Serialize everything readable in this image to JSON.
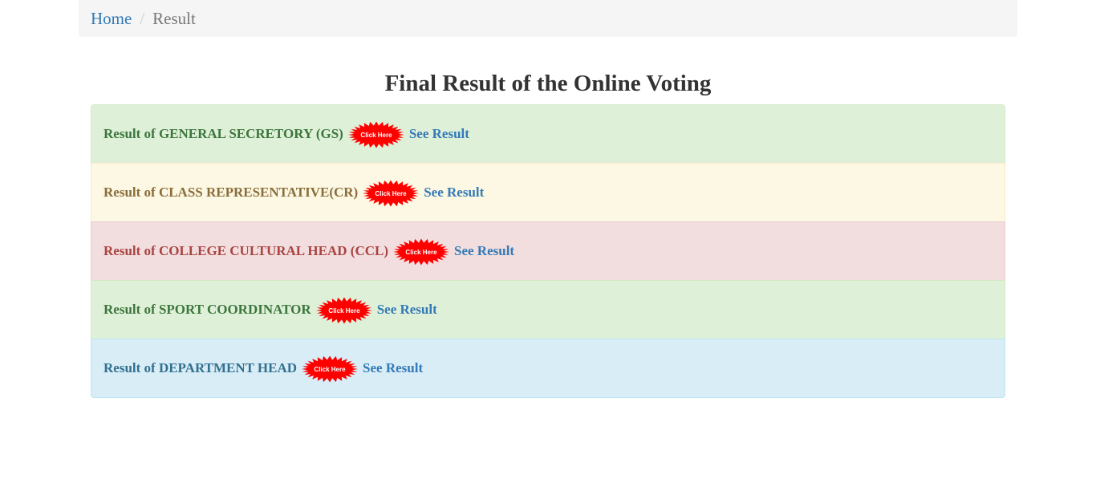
{
  "breadcrumb": {
    "home": "Home",
    "current": "Result"
  },
  "page_title": "Final Result of the Online Voting",
  "results": [
    {
      "label": "Result of GENERAL SECRETORY (GS)",
      "badge": "Click Here",
      "link": "See Result",
      "status": "success"
    },
    {
      "label": "Result of CLASS REPRESENTATIVE(CR)",
      "badge": "Click Here",
      "link": "See Result",
      "status": "warning"
    },
    {
      "label": "Result of COLLEGE CULTURAL HEAD (CCL)",
      "badge": "Click Here",
      "link": "See Result",
      "status": "danger"
    },
    {
      "label": "Result of SPORT COORDINATOR",
      "badge": "Click Here",
      "link": "See Result",
      "status": "success"
    },
    {
      "label": "Result of DEPARTMENT HEAD",
      "badge": "Click Here",
      "link": "See Result",
      "status": "info"
    }
  ],
  "colors": {
    "link": "#337ab7",
    "badge_fill": "#ff0000",
    "badge_text": "#ffffff",
    "success_bg": "#dff0d8",
    "warning_bg": "#fcf8e3",
    "danger_bg": "#f2dede",
    "info_bg": "#d9edf7"
  },
  "icons": {
    "badge": "starburst-click-here-icon"
  }
}
